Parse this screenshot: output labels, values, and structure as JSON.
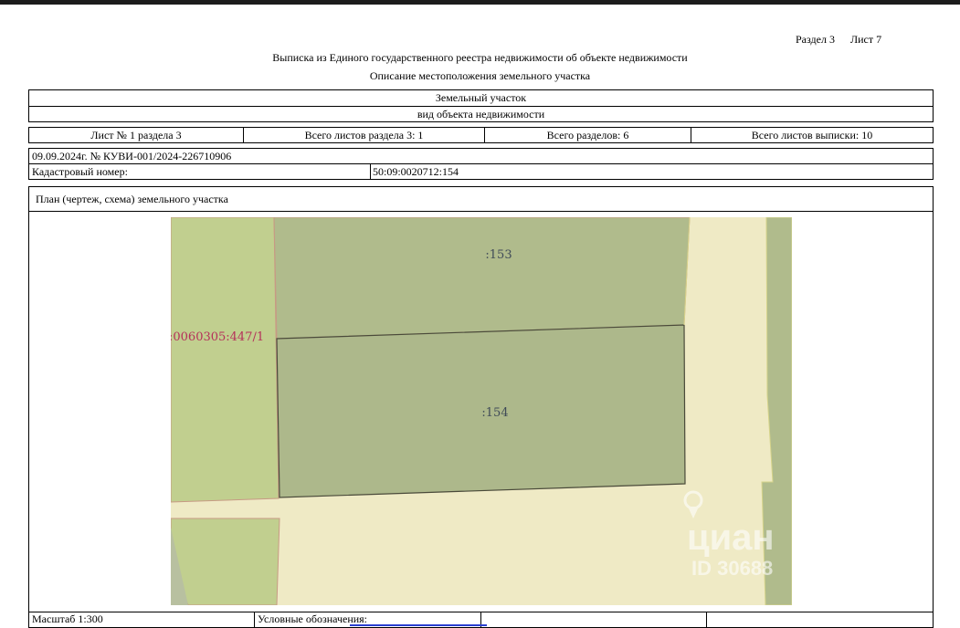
{
  "header": {
    "section": "Раздел 3",
    "sheet": "Лист 7",
    "title": "Выписка из Единого государственного реестра недвижимости об объекте недвижимости",
    "subtitle": "Описание местоположения земельного участка"
  },
  "object": {
    "type": "Земельный участок",
    "type_caption": "вид объекта недвижимости"
  },
  "sheet_info": {
    "sheet_of_section": "Лист № 1 раздела 3",
    "total_section_sheets": "Всего листов раздела 3: 1",
    "total_sections": "Всего разделов: 6",
    "total_extract_sheets": "Всего листов выписки: 10"
  },
  "record": {
    "date_number": "09.09.2024г. № КУВИ-001/2024-226710906",
    "cadastral_label": "Кадастровый номер:",
    "cadastral_value": "50:09:0020712:154"
  },
  "plan": {
    "title": "План (чертеж, схема) земельного участка",
    "parcel_labels": {
      "neighbor_top": ":153",
      "subject": ":154",
      "neighbor_left": ":0060305:447/1"
    },
    "watermark": {
      "brand": "циан",
      "id": "ID 30688"
    },
    "colors": {
      "background": "#efeac5",
      "light_green": "#c1cf8f",
      "dark_green": "#b0bb8c",
      "subject_fill": "#adb88b",
      "outline": "#4a4a3a",
      "neighbor_outline": "#c79a84"
    }
  },
  "footer": {
    "scale": "Масштаб 1:300",
    "legend": "Условные обозначения:"
  }
}
